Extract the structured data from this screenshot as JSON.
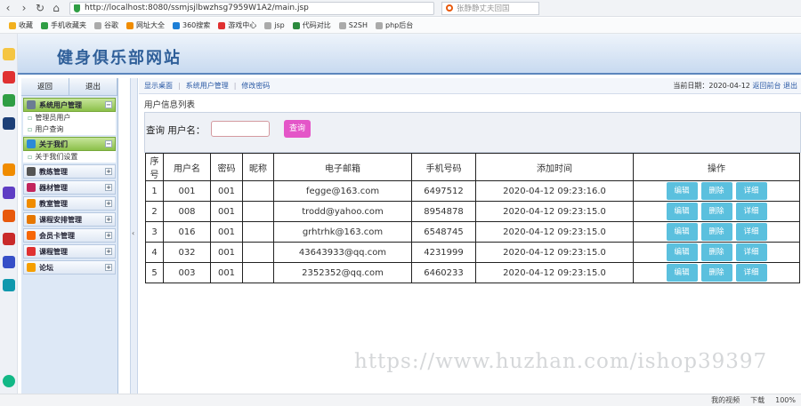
{
  "browser": {
    "url": "http://localhost:8080/ssmjsjlbwzhsg7959W1A2/main.jsp",
    "search_text": "张静静丈夫回国"
  },
  "bookmarks": [
    {
      "label": "收藏",
      "color": "#f2b01e"
    },
    {
      "label": "手机收藏夹",
      "color": "#2f9e44"
    },
    {
      "label": "谷歌",
      "color": "#aaaaaa"
    },
    {
      "label": "网址大全",
      "color": "#f08c00"
    },
    {
      "label": "360搜索",
      "color": "#1c7ed6"
    },
    {
      "label": "游戏中心",
      "color": "#e03131"
    },
    {
      "label": "jsp",
      "color": "#aaaaaa"
    },
    {
      "label": "代码对比",
      "color": "#2b8a3e"
    },
    {
      "label": "S2SH",
      "color": "#aaaaaa"
    },
    {
      "label": "php后台",
      "color": "#aaaaaa"
    }
  ],
  "header": {
    "site_title": "健身俱乐部网站"
  },
  "sidebar": {
    "top_buttons": [
      "返回",
      "退出"
    ],
    "groups": [
      {
        "label": "系统用户管理",
        "open": true,
        "items": [
          "管理员用户",
          "用户查询"
        ]
      },
      {
        "label": "关于我们",
        "open": true,
        "items": [
          "关于我们设置"
        ]
      },
      {
        "label": "教练管理",
        "open": false,
        "items": []
      },
      {
        "label": "器材管理",
        "open": false,
        "items": []
      },
      {
        "label": "教室管理",
        "open": false,
        "items": []
      },
      {
        "label": "课程安排管理",
        "open": false,
        "items": []
      },
      {
        "label": "会员卡管理",
        "open": false,
        "items": []
      },
      {
        "label": "课程管理",
        "open": false,
        "items": []
      },
      {
        "label": "论坛",
        "open": false,
        "items": []
      }
    ]
  },
  "breadcrumb": {
    "items": [
      "显示桌面",
      "系统用户管理",
      "修改密码"
    ],
    "date_label": "当前日期：2020-04-12",
    "back_link": "返回前台",
    "logout_link": "退出"
  },
  "main": {
    "list_title": "用户信息列表",
    "query_label": "查询 用户名：",
    "query_value": "",
    "query_button": "查询",
    "columns": [
      "序号",
      "用户名",
      "密码",
      "昵称",
      "电子邮箱",
      "手机号码",
      "添加时间",
      "操作"
    ],
    "rows": [
      {
        "no": "1",
        "username": "001",
        "password": "001",
        "nickname": "",
        "email": "fegge@163.com",
        "phone": "6497512",
        "time": "2020-04-12 09:23:16.0"
      },
      {
        "no": "2",
        "username": "008",
        "password": "001",
        "nickname": "",
        "email": "trodd@yahoo.com",
        "phone": "8954878",
        "time": "2020-04-12 09:23:15.0"
      },
      {
        "no": "3",
        "username": "016",
        "password": "001",
        "nickname": "",
        "email": "grhtrhk@163.com",
        "phone": "6548745",
        "time": "2020-04-12 09:23:15.0"
      },
      {
        "no": "4",
        "username": "032",
        "password": "001",
        "nickname": "",
        "email": "43643933@qq.com",
        "phone": "4231999",
        "time": "2020-04-12 09:23:15.0"
      },
      {
        "no": "5",
        "username": "003",
        "password": "001",
        "nickname": "",
        "email": "2352352@qq.com",
        "phone": "6460233",
        "time": "2020-04-12 09:23:15.0"
      }
    ],
    "actions": [
      "编辑",
      "删除",
      "详细"
    ]
  },
  "watermark": "https://www.huzhan.com/ishop39397",
  "statusbar": [
    "我的视频",
    "下载",
    "100%"
  ],
  "colors": {
    "accent": "#2f5f99",
    "query_button": "#e456c8",
    "action_button": "#5bc0de"
  }
}
